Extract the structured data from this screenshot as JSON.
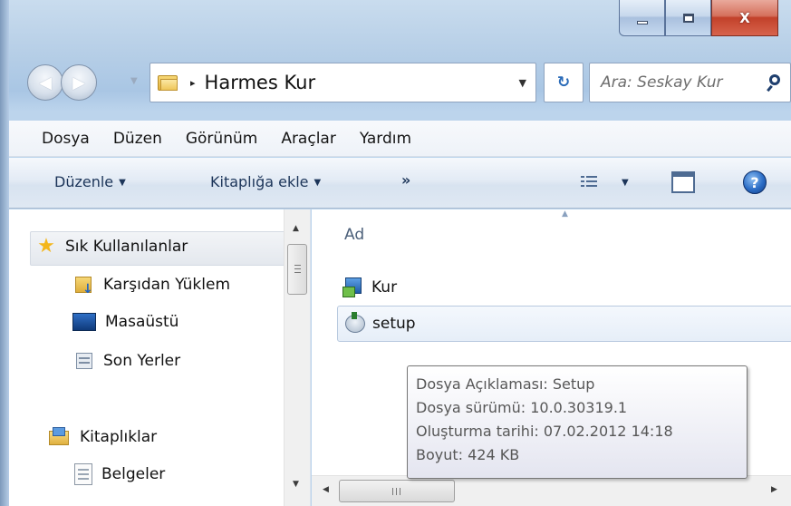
{
  "window": {
    "caption_buttons": [
      {
        "name": "minimize",
        "icon": "minimize-icon"
      },
      {
        "name": "maximize",
        "icon": "maximize-icon"
      },
      {
        "name": "close",
        "icon": "close-icon",
        "glyph": "X"
      }
    ]
  },
  "navigation": {
    "address_separator": "▸",
    "address_path": "Harmes Kur",
    "address_dropdown": "▼",
    "refresh_glyph": "⁺↺",
    "search_placeholder": "Ara: Seskay Kur"
  },
  "menu": {
    "items": [
      "Dosya",
      "Düzen",
      "Görünüm",
      "Araçlar",
      "Yardım"
    ]
  },
  "commands": {
    "organize": "Düzenle",
    "add_to_library": "Kitaplığa ekle",
    "more": "»",
    "help_glyph": "?",
    "caret": "▼"
  },
  "nav_pane": {
    "favorites_header": "Sık Kullanılanlar",
    "favorites": [
      {
        "label": "Karşıdan Yüklem",
        "icon": "downloads-folder-icon"
      },
      {
        "label": "Masaüstü",
        "icon": "desktop-icon"
      },
      {
        "label": "Son Yerler",
        "icon": "recent-places-icon"
      }
    ],
    "libraries_header": "Kitaplıklar",
    "libraries": [
      {
        "label": "Belgeler",
        "icon": "documents-icon"
      }
    ]
  },
  "file_list": {
    "column_header": "Ad",
    "files": [
      {
        "name": "Kur",
        "icon": "installer-icon"
      },
      {
        "name": "setup",
        "icon": "setup-icon",
        "selected": true
      }
    ]
  },
  "tooltip": {
    "description": "Dosya Açıklaması: Setup",
    "version": "Dosya sürümü: 10.0.30319.1",
    "created": "Oluşturma tarihi: 07.02.2012 14:18",
    "size": "Boyut: 424 KB"
  },
  "colors": {
    "title_glass": "#b7cfe7",
    "close_button": "#c2412a",
    "link_text": "#1c3559",
    "header_text": "#4c607a"
  }
}
